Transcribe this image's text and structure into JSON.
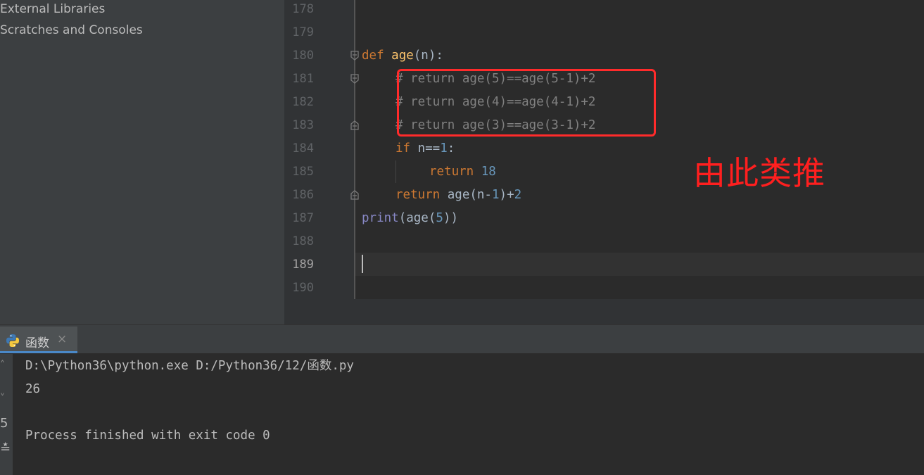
{
  "project_tree": {
    "items": [
      {
        "label": "External Libraries"
      },
      {
        "label": "Scratches and Consoles"
      }
    ]
  },
  "editor": {
    "current_line": "189",
    "line_numbers": [
      "178",
      "179",
      "180",
      "181",
      "182",
      "183",
      "184",
      "185",
      "186",
      "187",
      "188",
      "189",
      "190"
    ],
    "code": {
      "l180_kw": "def",
      "l180_fn": "age",
      "l180_rest": "(n):",
      "l181_comment": "# return age(5)==age(5-1)+2",
      "l182_comment": "# return age(4)==age(4-1)+2",
      "l183_comment": "# return age(3)==age(3-1)+2",
      "l184_kw": "if",
      "l184_a": " n==",
      "l184_num": "1",
      "l184_b": ":",
      "l185_kw": "return",
      "l185_num": "18",
      "l186_kw": "return",
      "l186_a": " age(n-",
      "l186_num1": "1",
      "l186_b": ")+",
      "l186_num2": "2",
      "l187_bi": "print",
      "l187_a": "(age(",
      "l187_num": "5",
      "l187_b": "))"
    },
    "annotation": "由此类推",
    "highlight_color": "#ff2b2b"
  },
  "run": {
    "tab_label": "函数",
    "tab_icon": "python-icon",
    "output": [
      "D:\\Python36\\python.exe D:/Python36/12/函数.py",
      "26",
      "",
      "Process finished with exit code 0"
    ]
  },
  "colors": {
    "keyword": "#cc7832",
    "function": "#ffc66d",
    "number": "#6897bb",
    "builtin": "#8888c6",
    "comment": "#808080",
    "text": "#a9b7c6",
    "background": "#2b2b2b"
  }
}
